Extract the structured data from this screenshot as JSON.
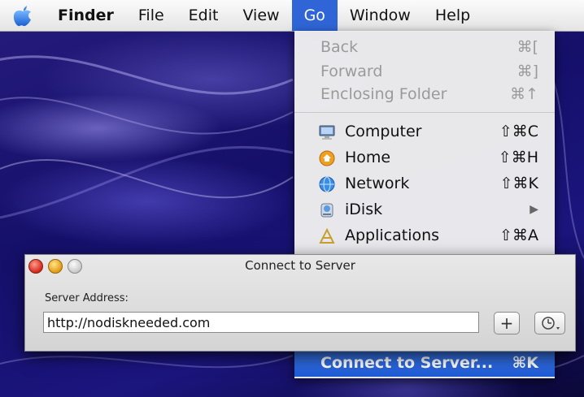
{
  "menubar": {
    "apple_icon": "apple-logo-icon",
    "items": [
      "Finder",
      "File",
      "Edit",
      "View",
      "Go",
      "Window",
      "Help"
    ],
    "active": "Go"
  },
  "go_menu": {
    "items": [
      {
        "label": "Back",
        "shortcut": "⌘[",
        "enabled": false
      },
      {
        "label": "Forward",
        "shortcut": "⌘]",
        "enabled": false
      },
      {
        "label": "Enclosing Folder",
        "shortcut": "⌘↑",
        "enabled": false
      },
      {
        "label": "Computer",
        "shortcut": "⇧⌘C",
        "icon": "computer-icon",
        "enabled": true
      },
      {
        "label": "Home",
        "shortcut": "⇧⌘H",
        "icon": "home-icon",
        "enabled": true
      },
      {
        "label": "Network",
        "shortcut": "⇧⌘K",
        "icon": "network-globe-icon",
        "enabled": true
      },
      {
        "label": "iDisk",
        "shortcut": "▶",
        "icon": "idisk-icon",
        "enabled": true
      },
      {
        "label": "Applications",
        "shortcut": "⇧⌘A",
        "icon": "applications-icon",
        "enabled": true
      },
      {
        "label": "Connect to Server...",
        "shortcut": "⌘K",
        "selected": true
      }
    ]
  },
  "dialog": {
    "title": "Connect to Server",
    "server_address_label": "Server Address:",
    "server_address_value": "http://nodiskneeded.com",
    "add_button": "+",
    "recent_icon": "clock-dropdown-icon"
  }
}
